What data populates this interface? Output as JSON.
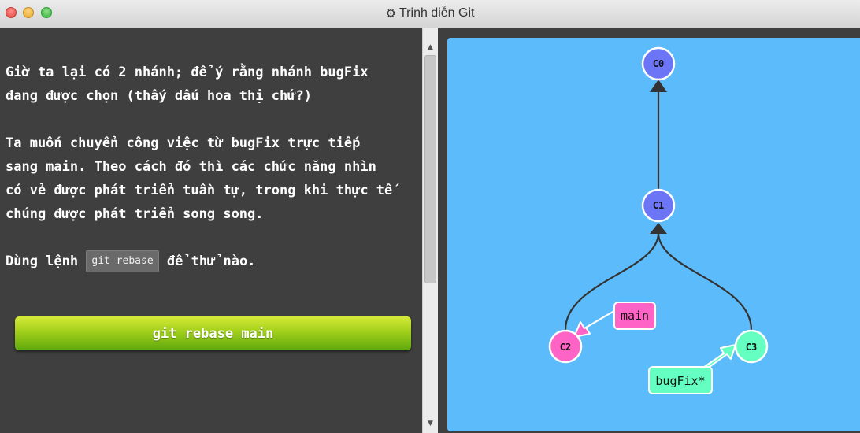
{
  "window": {
    "title": "Trinh diễn Git",
    "title_icon": "gear-icon"
  },
  "instructions": {
    "paragraphs": [
      [
        "Giờ ta lại có 2 nhánh; để ý rằng nhánh bugFix",
        "đang được chọn (thấy dấu hoa thị chứ?)"
      ],
      [
        "Ta muốn chuyển công việc từ bugFix trực tiếp",
        "sang main. Theo cách đó thì các chức năng nhìn",
        "có vẻ được phát triển tuần tự, trong khi thực tế",
        "chúng được phát triển song song."
      ]
    ],
    "try_prefix": "Dùng lệnh",
    "try_code": "git rebase",
    "try_suffix": "để thử nào."
  },
  "command_button": {
    "label": "git rebase main"
  },
  "colors": {
    "viz_background": "#5cbcfb",
    "commit_default": "#6b75f5",
    "commit_main": "#ff63c6",
    "commit_bugfix": "#64ffc1",
    "button_green": "#6cb514"
  },
  "graph": {
    "commits": [
      {
        "id": "C0",
        "color": "#6b75f5"
      },
      {
        "id": "C1",
        "color": "#6b75f5"
      },
      {
        "id": "C2",
        "color": "#ff63c6"
      },
      {
        "id": "C3",
        "color": "#64ffc1"
      }
    ],
    "edges": [
      {
        "from": "C1",
        "to": "C0"
      },
      {
        "from": "C2",
        "to": "C1"
      },
      {
        "from": "C3",
        "to": "C1"
      }
    ],
    "branches": [
      {
        "name": "main",
        "target": "C2",
        "color": "#ff63c6"
      },
      {
        "name": "bugFix*",
        "target": "C3",
        "color": "#64ffc1"
      }
    ]
  }
}
